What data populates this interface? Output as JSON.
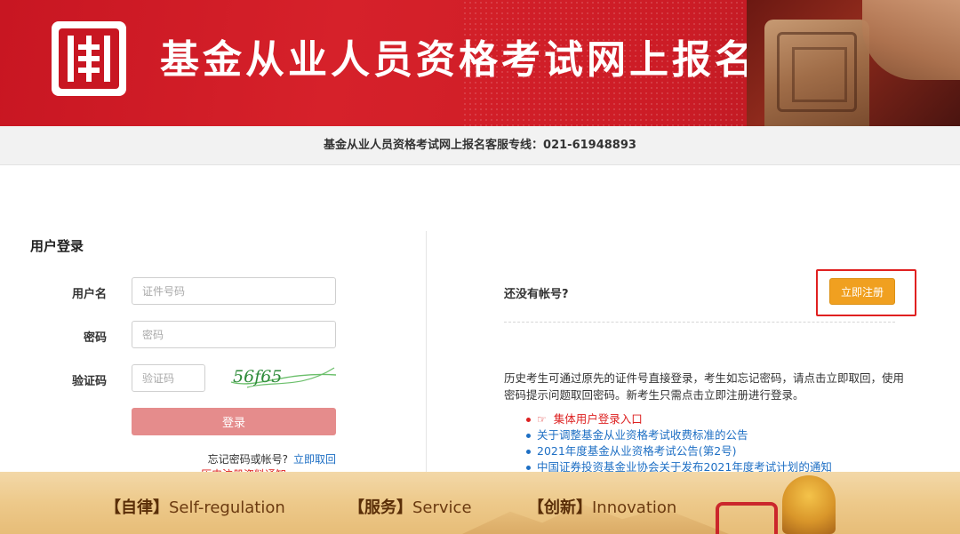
{
  "header": {
    "title": "基金从业人员资格考试网上报名",
    "hotline": "基金从业人员资格考试网上报名客服专线：021-61948893"
  },
  "login": {
    "title": "用户登录",
    "username_label": "用户名",
    "username_placeholder": "证件号码",
    "password_label": "密码",
    "password_placeholder": "密码",
    "captcha_label": "验证码",
    "captcha_placeholder": "验证码",
    "captcha_text": "56f65",
    "submit_label": "登录",
    "forgot_text": "忘记密码或帐号?",
    "forgot_link": "立即取回",
    "clipped_link": "历史注册资料通知..."
  },
  "register": {
    "no_account_text": "还没有帐号?",
    "register_label": "立即注册"
  },
  "info": {
    "text": "历史考生可通过原先的证件号直接登录，考生如忘记密码，请点击立即取回，使用密码提示问题取回密码。新考生只需点击立即注册进行登录。",
    "notices": [
      {
        "label": "集体用户登录入口"
      },
      {
        "label": "关于调整基金从业资格考试收费标准的公告"
      },
      {
        "label": "2021年度基金从业资格考试公告(第2号)"
      },
      {
        "label": "中国证券投资基金业协会关于发布2021年度考试计划的通知"
      }
    ]
  },
  "footer": {
    "slogans": [
      {
        "cn": "【自律】",
        "en": "Self-regulation"
      },
      {
        "cn": "【服务】",
        "en": "Service"
      },
      {
        "cn": "【创新】",
        "en": "Innovation"
      }
    ]
  },
  "colors": {
    "brand_red": "#c81622",
    "register_orange": "#f0a020",
    "link_blue": "#1e6fc4",
    "highlight_red": "#e02020"
  }
}
